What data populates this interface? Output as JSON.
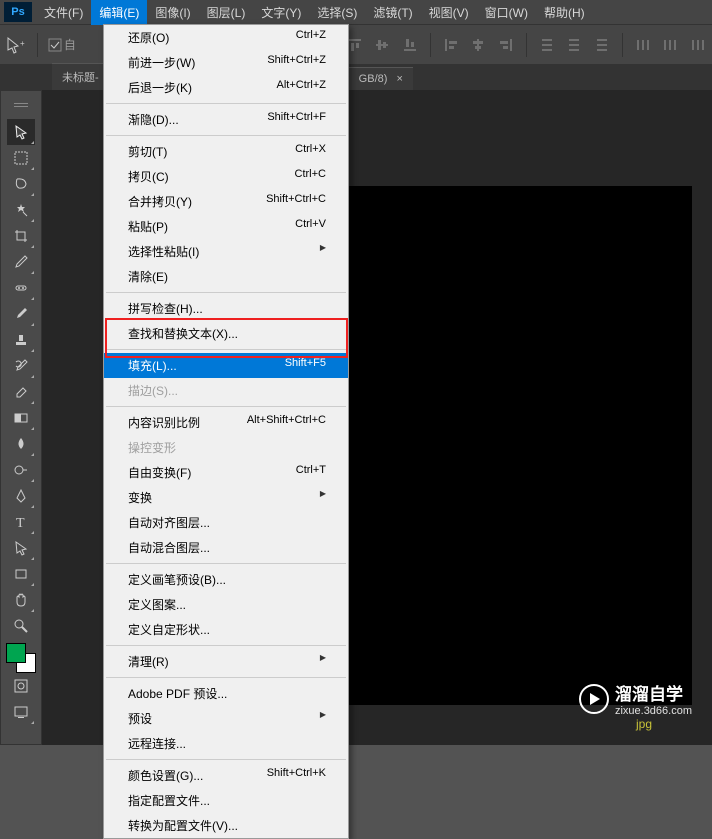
{
  "menubar": {
    "items": [
      {
        "label": "文件(F)"
      },
      {
        "label": "编辑(E)"
      },
      {
        "label": "图像(I)"
      },
      {
        "label": "图层(L)"
      },
      {
        "label": "文字(Y)"
      },
      {
        "label": "选择(S)"
      },
      {
        "label": "滤镜(T)"
      },
      {
        "label": "视图(V)"
      },
      {
        "label": "窗口(W)"
      },
      {
        "label": "帮助(H)"
      }
    ]
  },
  "tabs": {
    "doc1": "未标题-",
    "doc2": "GB/8)",
    "close": "×"
  },
  "options": {
    "checkbox_label": "自"
  },
  "dropdown": {
    "items": [
      {
        "label": "还原(O)",
        "shortcut": "Ctrl+Z"
      },
      {
        "label": "前进一步(W)",
        "shortcut": "Shift+Ctrl+Z"
      },
      {
        "label": "后退一步(K)",
        "shortcut": "Alt+Ctrl+Z"
      },
      {
        "sep": true
      },
      {
        "label": "渐隐(D)...",
        "shortcut": "Shift+Ctrl+F"
      },
      {
        "sep": true
      },
      {
        "label": "剪切(T)",
        "shortcut": "Ctrl+X"
      },
      {
        "label": "拷贝(C)",
        "shortcut": "Ctrl+C"
      },
      {
        "label": "合并拷贝(Y)",
        "shortcut": "Shift+Ctrl+C"
      },
      {
        "label": "粘贴(P)",
        "shortcut": "Ctrl+V"
      },
      {
        "label": "选择性粘贴(I)",
        "sub": true
      },
      {
        "label": "清除(E)"
      },
      {
        "sep": true
      },
      {
        "label": "拼写检查(H)..."
      },
      {
        "label": "查找和替换文本(X)..."
      },
      {
        "sep": true
      },
      {
        "label": "填充(L)...",
        "shortcut": "Shift+F5",
        "highlighted": true
      },
      {
        "label": "描边(S)...",
        "disabled": true
      },
      {
        "sep": true
      },
      {
        "label": "内容识别比例",
        "shortcut": "Alt+Shift+Ctrl+C"
      },
      {
        "label": "操控变形",
        "disabled": true
      },
      {
        "label": "自由变换(F)",
        "shortcut": "Ctrl+T"
      },
      {
        "label": "变换",
        "sub": true
      },
      {
        "label": "自动对齐图层..."
      },
      {
        "label": "自动混合图层..."
      },
      {
        "sep": true
      },
      {
        "label": "定义画笔预设(B)..."
      },
      {
        "label": "定义图案..."
      },
      {
        "label": "定义自定形状..."
      },
      {
        "sep": true
      },
      {
        "label": "清理(R)",
        "sub": true
      },
      {
        "sep": true
      },
      {
        "label": "Adobe PDF 预设..."
      },
      {
        "label": "预设",
        "sub": true
      },
      {
        "label": "远程连接..."
      },
      {
        "sep": true
      },
      {
        "label": "颜色设置(G)...",
        "shortcut": "Shift+Ctrl+K"
      },
      {
        "label": "指定配置文件..."
      },
      {
        "label": "转换为配置文件(V)..."
      }
    ]
  },
  "watermark": {
    "brand": "溜溜自学",
    "url": "zixue.3d66.com"
  },
  "canvas": {
    "format_label": "jpg"
  }
}
